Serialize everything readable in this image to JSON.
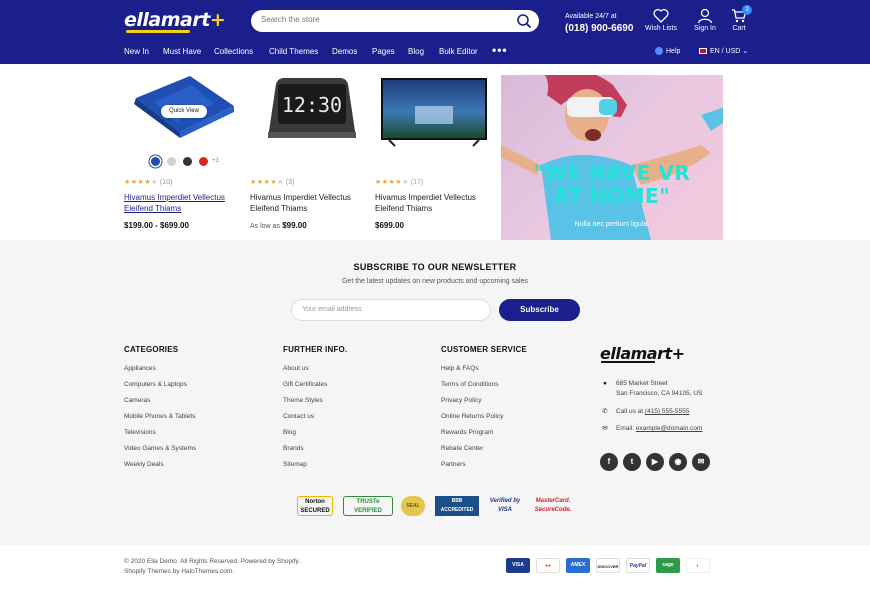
{
  "header": {
    "logo_main": "ellamart",
    "logo_plus": "+",
    "search_placeholder": "Search the store",
    "availability": "Available 24/7 at",
    "phone": "(018) 900-6690",
    "wishlist_label": "Wish Lists",
    "signin_label": "Sign In",
    "cart_label": "Cart",
    "cart_count": "3",
    "help_label": "Help",
    "locale_label": "EN / USD"
  },
  "nav": {
    "items": [
      "New In",
      "Must Have",
      "Collections",
      "Child Themes",
      "Demos",
      "Pages",
      "Blog",
      "Bulk Editor"
    ],
    "more": "•••"
  },
  "products": [
    {
      "reviews": "(10)",
      "stars": 4,
      "title": "Hivamus Imperdiet Vellectus Eleifend Thiams",
      "price": "$199.00 - $699.00",
      "quick_view": "Quick View",
      "swatch_more": "+3",
      "swatch_colors": [
        "#1f4fb3",
        "#d0d0d0",
        "#333333",
        "#d42a1e"
      ]
    },
    {
      "reviews": "(3)",
      "stars": 4,
      "title": "Hivamus Imperdiet Vellectus Eleifend Thiams",
      "price_prefix": "As low as",
      "price": "$99.00"
    },
    {
      "reviews": "(17)",
      "stars": 4,
      "title": "Hivamus Imperdiet Vellectus Eleifend Thiams",
      "price": "$699.00"
    }
  ],
  "clock_time": "12:30",
  "banner": {
    "title_line1": "\"WE HAVE VR",
    "title_line2": "AT HOME\"",
    "subtitle": "Nulla nec pretium ligula."
  },
  "newsletter": {
    "title": "SUBSCRIBE TO OUR NEWSLETTER",
    "subtitle": "Get the latest updates on new products and upcoming sales",
    "placeholder": "Your email address",
    "button": "Subscribe"
  },
  "footer": {
    "categories": {
      "title": "CATEGORIES",
      "links": [
        "Appliances",
        "Computers & Laptops",
        "Cameras",
        "Mobile Phones & Tablets",
        "Televisions",
        "Video Games & Systems",
        "Weekly Deals"
      ]
    },
    "further": {
      "title": "FURTHER INFO.",
      "links": [
        "About us",
        "Gift Certificates",
        "Theme Styles",
        "Contact us",
        "Blog",
        "Brands",
        "Sitemap"
      ]
    },
    "service": {
      "title": "CUSTOMER SERVICE",
      "links": [
        "Help & FAQs",
        "Terms of Conditions",
        "Privacy Policy",
        "Online Returns Policy",
        "Rewards Program",
        "Rebate Center",
        "Partners"
      ]
    },
    "contact": {
      "logo_main": "ellamart",
      "logo_plus": "+",
      "address_line1": "685 Market Street",
      "address_line2": "San Francisco, CA 94105, US",
      "call_prefix": "Call us at",
      "call_number": "(415) 555-5555",
      "email_prefix": "Email:",
      "email": "example@domain.com"
    },
    "social": [
      "f",
      "t",
      "▶",
      "◉",
      "✉"
    ],
    "trust_badges": [
      "Norton SECURED",
      "TRUSTe VERIFIED",
      "SEAL",
      "BBB ACCREDITED BUSINESS",
      "Verified by VISA",
      "MasterCard. SecureCode."
    ],
    "copyright_line1": "© 2020 Ella Demo. All Rights Reserved. Powered by Shopify.",
    "copyright_line2": "Shopify Themes by HaloThemes.com.",
    "payments": [
      "VISA",
      "●●",
      "AMEX",
      "DISCOVER",
      "PayPal",
      "sage",
      "◐"
    ]
  },
  "colors": {
    "brand": "#1b1f8c",
    "accent": "#f5d113",
    "banner_text": "#20e3d9"
  }
}
